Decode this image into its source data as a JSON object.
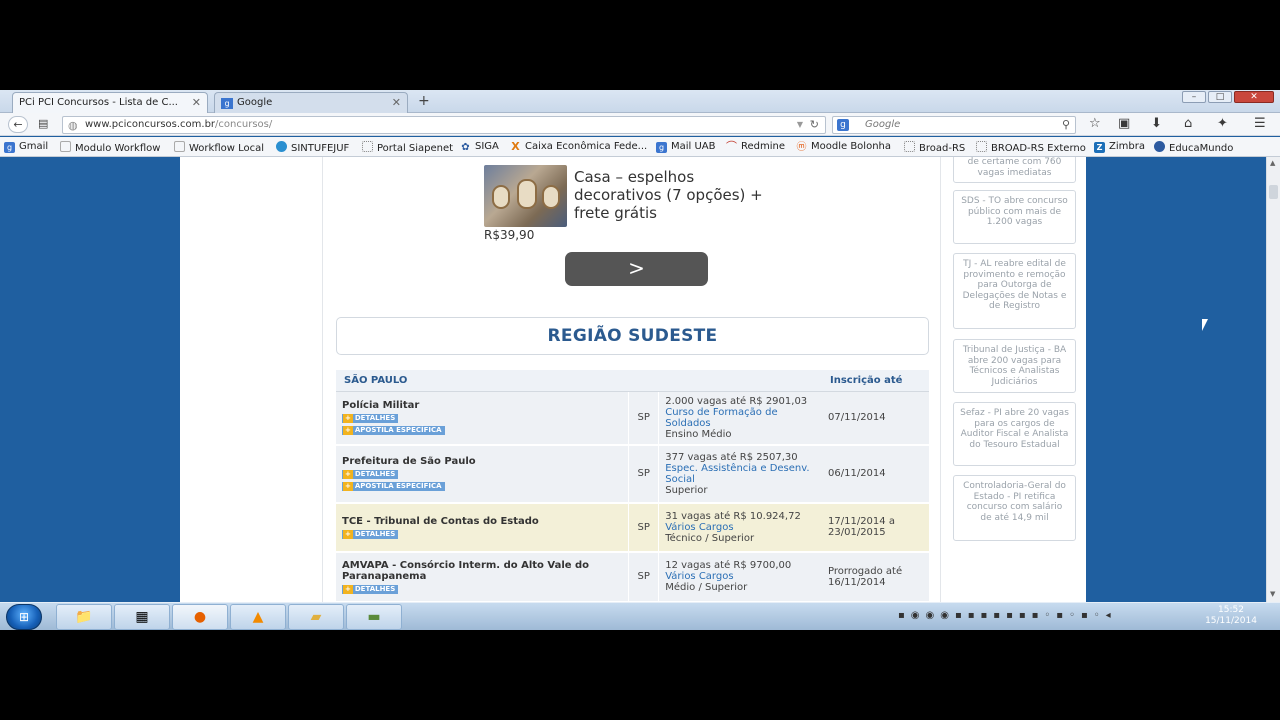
{
  "tabs": [
    {
      "icon": "PCi",
      "label": "PCi  PCI Concursos - Lista de C..."
    },
    {
      "icon": "g",
      "label": "Google"
    }
  ],
  "address": {
    "domain": "www.pciconcursos.com.br",
    "path": "/concursos/"
  },
  "search": {
    "placeholder": "Google"
  },
  "bookmarks": [
    {
      "label": "Gmail"
    },
    {
      "label": "Modulo Workflow"
    },
    {
      "label": "Workflow Local"
    },
    {
      "label": "SINTUFEJUF"
    },
    {
      "label": "Portal Siapenet"
    },
    {
      "label": "SIGA"
    },
    {
      "label": "Caixa Econômica Fede..."
    },
    {
      "label": "Mail UAB"
    },
    {
      "label": "Redmine"
    },
    {
      "label": "Moodle Bolonha"
    },
    {
      "label": "Broad-RS"
    },
    {
      "label": "BROAD-RS Externo"
    },
    {
      "label": "Zimbra"
    },
    {
      "label": "EducaMundo"
    }
  ],
  "ad": {
    "title": "Casa – espelhos decorativos (7 opções) + frete grátis",
    "price": "R$39,90",
    "button": ">"
  },
  "region": "REGIÃO SUDESTE",
  "table": {
    "state": "SÃO PAULO",
    "date_header": "Inscrição até",
    "detail_label": "DETALHES",
    "apostila_label": "APOSTILA ESPECÍFICA",
    "rows": [
      {
        "org": "Polícia Militar",
        "uf": "SP",
        "vagas": "2.000 vagas até R$ 2901,03",
        "cargo": "Curso de Formação de Soldados",
        "nivel": "Ensino Médio",
        "date": "07/11/2014"
      },
      {
        "org": "Prefeitura de São Paulo",
        "uf": "SP",
        "vagas": "377 vagas até R$ 2507,30",
        "cargo": "Espec. Assistência e Desenv. Social",
        "nivel": "Superior",
        "date": "06/11/2014"
      },
      {
        "org": "TCE - Tribunal de Contas do Estado",
        "uf": "SP",
        "vagas": "31 vagas até R$ 10.924,72",
        "cargo": "Vários Cargos",
        "nivel": "Técnico / Superior",
        "date": "17/11/2014 a 23/01/2015"
      },
      {
        "org": "AMVAPA - Consórcio Interm. do Alto Vale do Paranapanema",
        "uf": "SP",
        "vagas": "12 vagas até R$ 9700,00",
        "cargo": "Vários Cargos",
        "nivel": "Médio / Superior",
        "date": "Prorrogado até 16/11/2014"
      }
    ]
  },
  "news": [
    "de certame com 760 vagas imediatas",
    "SDS - TO abre concurso público com mais de 1.200 vagas",
    "TJ - AL reabre edital de provimento e remoção para Outorga de Delegações de Notas e de Registro",
    "Tribunal de Justiça - BA abre 200 vagas para Técnicos e Analistas Judiciários",
    "Sefaz - PI abre 20 vagas para os cargos de Auditor Fiscal e Analista do Tesouro Estadual",
    "Controladoria-Geral do Estado - PI retifica concurso com salário de até 14,9 mil"
  ],
  "clock": {
    "time": "15:52",
    "date": "15/11/2014"
  }
}
